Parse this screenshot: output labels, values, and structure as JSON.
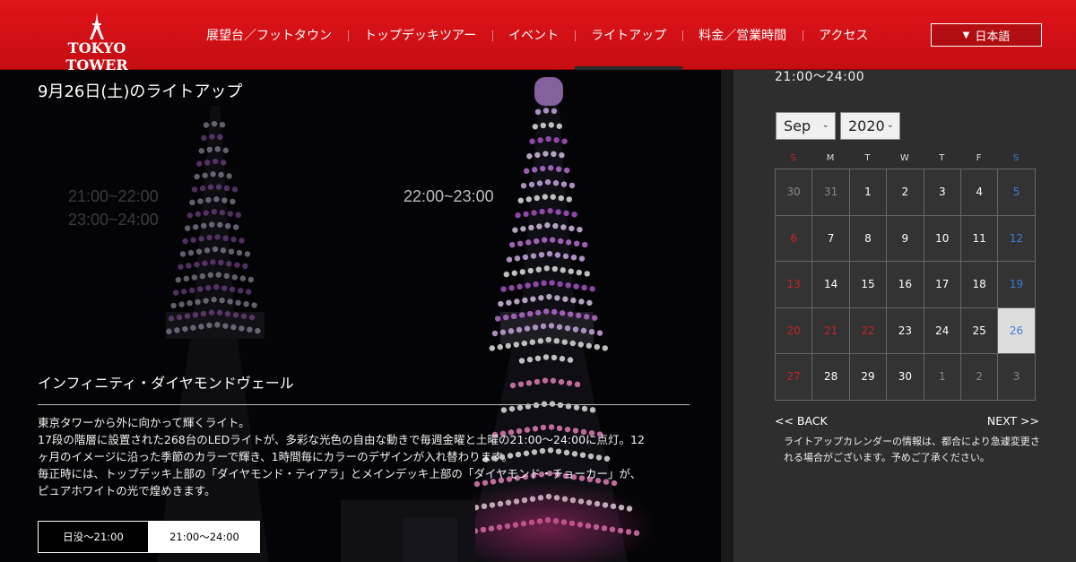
{
  "header": {
    "logo_text": "TOKYO TOWER",
    "nav": [
      "展望台／フットタウン",
      "トップデッキツアー",
      "イベント",
      "ライトアップ",
      "料金／営業時間",
      "アクセス"
    ],
    "active_nav": "ライトアップ",
    "language": "日本語"
  },
  "hero": {
    "title": "9月26日(土)のライトアップ",
    "ghost_times": [
      "21:00~22:00",
      "23:00~24:00",
      "22:00~23:00"
    ],
    "design_name": "インフィニティ・ダイヤモンドヴェール",
    "description": [
      "東京タワーから外に向かって輝くライト。",
      "17段の階層に設置された268台のLEDライトが、多彩な光色の自由な動きで毎週金曜と土曜の21:00～24:00に点灯。12",
      "ヶ月のイメージに沿った季節のカラーで輝き、1時間毎にカラーのデザインが入れ替わります。",
      "毎正時には、トップデッキ上部の「ダイヤモンド・ティアラ」とメインデッキ上部の「ダイヤモンド・チョーカー」が、",
      "ピュアホワイトの光で煌めきます。"
    ],
    "time_tabs": [
      "日没～21:00",
      "21:00～24:00"
    ]
  },
  "side": {
    "time": "21:00～24:00",
    "month": "Sep",
    "year": "2020",
    "weekdays": [
      "S",
      "M",
      "T",
      "W",
      "T",
      "F",
      "S"
    ],
    "weeks": [
      [
        "30",
        "31",
        "1",
        "2",
        "3",
        "4",
        "5"
      ],
      [
        "6",
        "7",
        "8",
        "9",
        "10",
        "11",
        "12"
      ],
      [
        "13",
        "14",
        "15",
        "16",
        "17",
        "18",
        "19"
      ],
      [
        "20",
        "21",
        "22",
        "23",
        "24",
        "25",
        "26"
      ],
      [
        "27",
        "28",
        "29",
        "30",
        "1",
        "2",
        "3"
      ]
    ],
    "selected_day": "26",
    "prev": "<< BACK",
    "next": "NEXT >>",
    "note": "ライトアップカレンダーの情報は、都合により急遽変更される場合がございます。予めご了承ください。"
  },
  "colors": {
    "header_red": "#d51016",
    "sunday": "#cc2222",
    "saturday": "#3b7dd8"
  }
}
